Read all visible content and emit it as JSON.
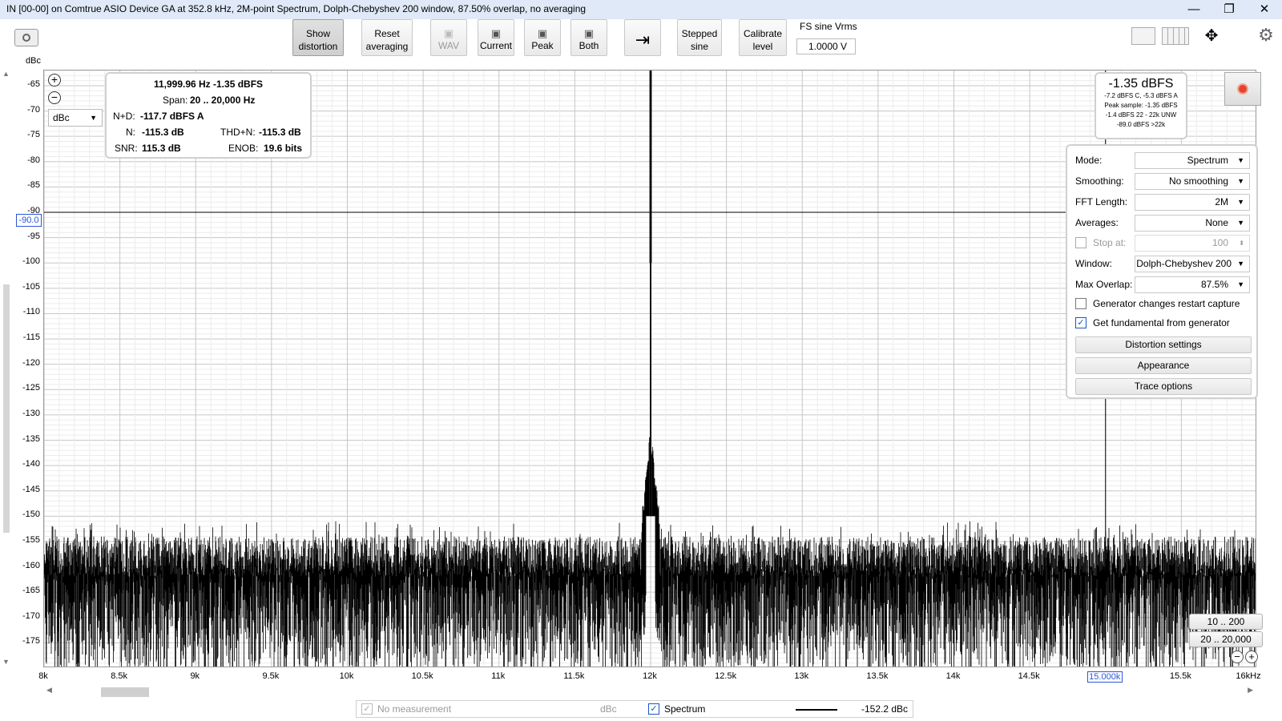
{
  "window": {
    "title": "IN [00-00] on Comtrue ASIO Device GA at 352.8 kHz, 2M-point Spectrum, Dolph-Chebyshev 200 window, 87.50% overlap, no averaging",
    "minimize": "—",
    "maximize": "❐",
    "close": "✕"
  },
  "toolbar": {
    "show_distortion": [
      "Show",
      "distortion"
    ],
    "reset_averaging": [
      "Reset",
      "averaging"
    ],
    "wav": "WAV",
    "current": "Current",
    "peak": "Peak",
    "both": "Both",
    "stepped_sine": [
      "Stepped",
      "sine"
    ],
    "calibrate_level": [
      "Calibrate",
      "level"
    ],
    "fs_sine_label": "FS sine Vrms",
    "fs_sine_value": "1.0000 V"
  },
  "distortion": {
    "freq_level": "11,999.96 Hz  -1.35 dBFS",
    "span_label": "Span:",
    "span_value": "20 .. 20,000 Hz",
    "nd_label": "N+D:",
    "nd_value": "-117.7 dBFS A",
    "n_label": "N:",
    "n_value": "-115.3 dB",
    "thdn_label": "THD+N:",
    "thdn_value": "-115.3 dB",
    "snr_label": "SNR:",
    "snr_value": "115.3 dB",
    "enob_label": "ENOB:",
    "enob_value": "19.6 bits"
  },
  "unit_select": "dBc",
  "level_meter": {
    "main": "-1.35 dBFS",
    "line1": "-7.2 dBFS C, -5.3 dBFS A",
    "line2": "Peak sample: -1.35 dBFS",
    "line3": "-1.4 dBFS 22 - 22k UNW",
    "line4": "-89.0 dBFS >22k"
  },
  "controls": {
    "mode_label": "Mode:",
    "mode_value": "Spectrum",
    "smoothing_label": "Smoothing:",
    "smoothing_value": "No smoothing",
    "fft_label": "FFT Length:",
    "fft_value": "2M",
    "averages_label": "Averages:",
    "averages_value": "None",
    "stop_at_label": "Stop at:",
    "stop_at_value": "100",
    "window_label": "Window:",
    "window_value": "Dolph-Chebyshev 200",
    "overlap_label": "Max Overlap:",
    "overlap_value": "87.5%",
    "gen_restart": "Generator changes restart capture",
    "get_fundamental": "Get fundamental from generator",
    "distortion_settings": "Distortion settings",
    "appearance": "Appearance",
    "trace_options": "Trace options"
  },
  "range_buttons": {
    "r1": "10 .. 200",
    "r2": "20 .. 20,000"
  },
  "cursor": {
    "y_value": "-90.0",
    "x_value": "15.000k"
  },
  "legend": {
    "no_measurement": "No measurement",
    "unit": "dBc",
    "spectrum": "Spectrum",
    "spectrum_value": "-152.2 dBc"
  },
  "chart_data": {
    "type": "line",
    "ylabel": "dBc",
    "xlabel": "",
    "xlim": [
      8000,
      16000
    ],
    "ylim": [
      -180,
      -62
    ],
    "x_ticks": [
      "8k",
      "8.5k",
      "9k",
      "9.5k",
      "10k",
      "10.5k",
      "11k",
      "11.5k",
      "12k",
      "12.5k",
      "13k",
      "13.5k",
      "14k",
      "14.5k",
      "15.000k",
      "15.5k",
      "16kHz"
    ],
    "x_tick_values": [
      8000,
      8500,
      9000,
      9500,
      10000,
      10500,
      11000,
      11500,
      12000,
      12500,
      13000,
      13500,
      14000,
      14500,
      15000,
      15500,
      16000
    ],
    "y_ticks": [
      -65,
      -70,
      -75,
      -80,
      -85,
      -90,
      -95,
      -100,
      -105,
      -110,
      -115,
      -120,
      -125,
      -130,
      -135,
      -140,
      -145,
      -150,
      -155,
      -160,
      -165,
      -170,
      -175
    ],
    "series": [
      {
        "name": "Spectrum",
        "color": "#000000",
        "peak": {
          "x": 12000,
          "y": -62
        },
        "noise_floor_top": -152,
        "noise_floor_bottom": -180
      }
    ],
    "cursor": {
      "x": 15000,
      "y": -90
    },
    "grid": true
  }
}
